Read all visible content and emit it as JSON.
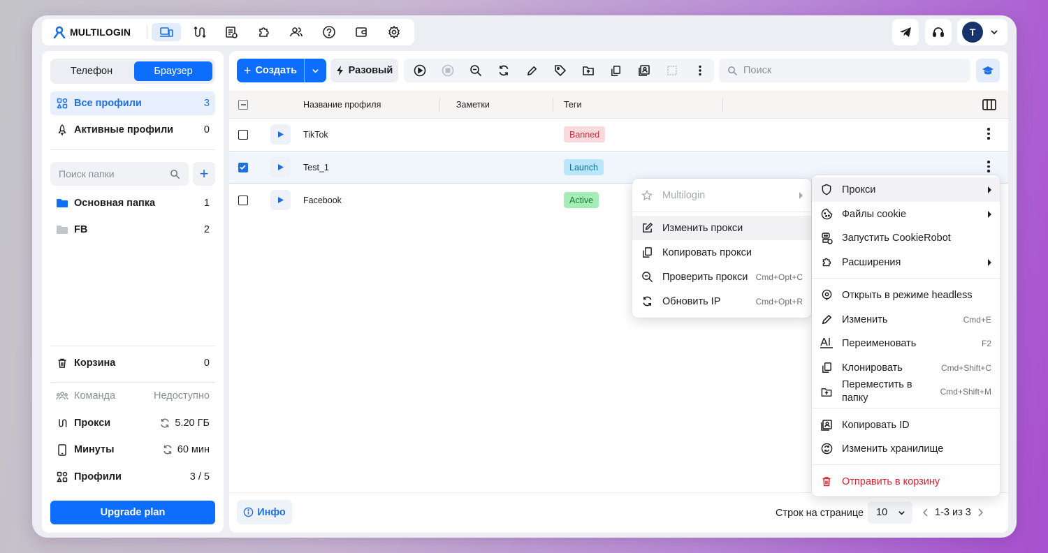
{
  "app": {
    "name": "MULTILOGIN"
  },
  "header": {
    "avatar_initial": "T"
  },
  "sidebar": {
    "segments": [
      "Телефон",
      "Браузер"
    ],
    "all_profiles": {
      "label": "Все профили",
      "count": "3"
    },
    "active_profiles": {
      "label": "Активные профили",
      "count": "0"
    },
    "folder_search_placeholder": "Поиск папки",
    "add_label": "+",
    "folders": [
      {
        "label": "Основная папка",
        "count": "1"
      },
      {
        "label": "FB",
        "count": "2"
      }
    ],
    "trash": {
      "label": "Корзина",
      "count": "0"
    },
    "team": {
      "label": "Команда",
      "value": "Недоступно"
    },
    "proxy": {
      "label": "Прокси",
      "value": "5.20 ГБ"
    },
    "minutes": {
      "label": "Минуты",
      "value": "60 мин"
    },
    "profiles": {
      "label": "Профили",
      "value": "3 / 5"
    },
    "upgrade_label": "Upgrade plan"
  },
  "toolbar": {
    "create_label": "Создать",
    "once_label": "Разовый",
    "search_placeholder": "Поиск"
  },
  "table": {
    "columns": [
      "Название профиля",
      "Заметки",
      "Теги"
    ],
    "rows": [
      {
        "name": "TikTok",
        "tag": "Banned",
        "tag_color": "#fbdadd",
        "tag_text": "#c8313f",
        "selected": false
      },
      {
        "name": "Test_1",
        "tag": "Launch",
        "tag_color": "#b9e6fb",
        "tag_text": "#0b6c96",
        "selected": true
      },
      {
        "name": "Facebook",
        "tag": "Active",
        "tag_color": "#a6ecb6",
        "tag_text": "#187a35",
        "selected": false
      }
    ]
  },
  "footer": {
    "info_label": "Инфо",
    "rows_per_page_label": "Строк на странице",
    "rows_per_page": "10",
    "range": "1-3 из 3"
  },
  "proxy_submenu": {
    "header": "Multilogin",
    "items": [
      {
        "label": "Изменить прокси",
        "shortcut": ""
      },
      {
        "label": "Копировать прокси",
        "shortcut": ""
      },
      {
        "label": "Проверить прокси",
        "shortcut": "Cmd+Opt+C"
      },
      {
        "label": "Обновить IP",
        "shortcut": "Cmd+Opt+R"
      }
    ]
  },
  "context_menu": {
    "proxy": "Прокси",
    "cookies": "Файлы cookie",
    "cookierobot": "Запустить CookieRobot",
    "extensions": "Расширения",
    "headless": "Открыть в режиме headless",
    "edit": {
      "label": "Изменить",
      "shortcut": "Cmd+E"
    },
    "rename": {
      "label": "Переименовать",
      "shortcut": "F2"
    },
    "clone": {
      "label": "Клонировать",
      "shortcut": "Cmd+Shift+C"
    },
    "move": {
      "line1": "Переместить в",
      "line2": "папку",
      "shortcut": "Cmd+Shift+M"
    },
    "copy_id": "Копировать ID",
    "storage": "Изменить хранилище",
    "trash": "Отправить в корзину"
  },
  "colors": {
    "accent": "#0d6efd",
    "danger": "#d8222f",
    "avatar": "#17336b"
  }
}
